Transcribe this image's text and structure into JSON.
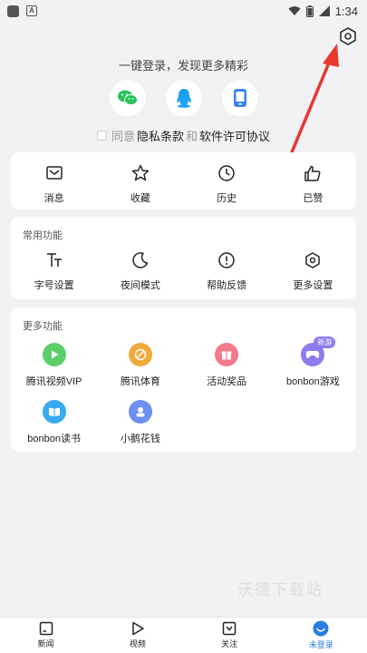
{
  "status_bar": {
    "time": "1:34"
  },
  "header": {
    "settings_icon": "gear-hexagon-icon"
  },
  "login": {
    "prompt": "一键登录，发现更多精彩",
    "methods": [
      {
        "name": "wechat",
        "icon": "wechat-icon",
        "color": "#2ac15d"
      },
      {
        "name": "qq",
        "icon": "qq-icon",
        "color": "#1ea1f2"
      },
      {
        "name": "phone",
        "icon": "phone-icon",
        "color": "#3b82f6"
      }
    ],
    "agreement_prefix": "同意",
    "privacy": "隐私条款",
    "and": "和",
    "license": "软件许可协议"
  },
  "quick_actions": [
    {
      "label": "消息",
      "icon": "message-icon"
    },
    {
      "label": "收藏",
      "icon": "star-icon"
    },
    {
      "label": "历史",
      "icon": "clock-icon"
    },
    {
      "label": "已赞",
      "icon": "thumbs-up-icon"
    }
  ],
  "common": {
    "title": "常用功能",
    "items": [
      {
        "label": "字号设置",
        "icon": "font-size-icon"
      },
      {
        "label": "夜间模式",
        "icon": "moon-icon"
      },
      {
        "label": "帮助反馈",
        "icon": "help-icon"
      },
      {
        "label": "更多设置",
        "icon": "settings-icon"
      }
    ]
  },
  "more": {
    "title": "更多功能",
    "items": [
      {
        "label": "腾讯视频VIP",
        "icon": "video-play-icon",
        "color": "#5ccf6c"
      },
      {
        "label": "腾讯体育",
        "icon": "sports-icon",
        "color": "#f0a93a"
      },
      {
        "label": "活动奖品",
        "icon": "gift-icon",
        "color": "#f37a8a"
      },
      {
        "label": "bonbon游戏",
        "icon": "game-controller-icon",
        "color": "#8c7cf0",
        "badge": "新游"
      },
      {
        "label": "bonbon读书",
        "icon": "book-icon",
        "color": "#39a9f0"
      },
      {
        "label": "小鹅花钱",
        "icon": "wallet-icon",
        "color": "#6d8ff0"
      }
    ]
  },
  "watermark": "沃德下载站",
  "tabs": [
    {
      "label": "新闻",
      "icon": "news-icon",
      "active": false
    },
    {
      "label": "视频",
      "icon": "video-icon",
      "active": false
    },
    {
      "label": "关注",
      "icon": "follow-icon",
      "active": false
    },
    {
      "label": "未登录",
      "icon": "user-avatar-icon",
      "active": true
    }
  ],
  "colors": {
    "accent": "#2a7de1",
    "annotation_arrow": "#e8382f"
  }
}
